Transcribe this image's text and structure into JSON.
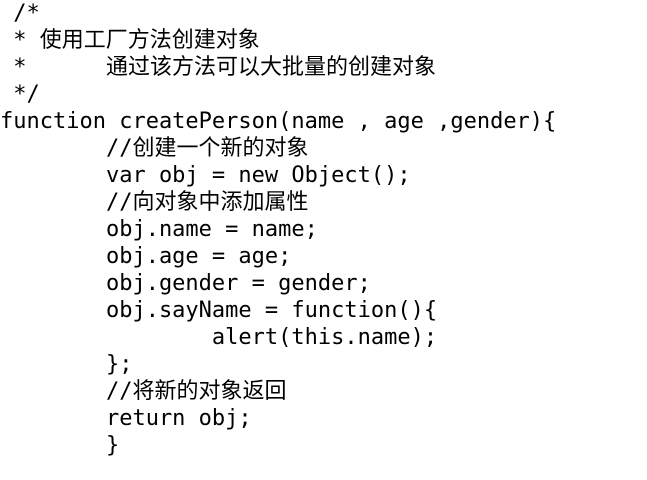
{
  "code": {
    "lines": [
      " /*",
      " * 使用工厂方法创建对象",
      " *      通过该方法可以大批量的创建对象",
      " */",
      "function createPerson(name , age ,gender){",
      "        //创建一个新的对象",
      "        var obj = new Object();",
      "        //向对象中添加属性",
      "        obj.name = name;",
      "        obj.age = age;",
      "        obj.gender = gender;",
      "        obj.sayName = function(){",
      "                alert(this.name);",
      "        };",
      "        //将新的对象返回",
      "        return obj;",
      "        }"
    ]
  }
}
